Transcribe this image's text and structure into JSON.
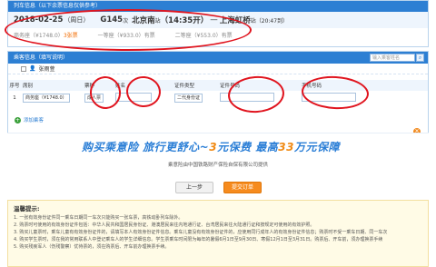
{
  "train": {
    "header_title": "列车信息（以下余票信息仅供参考）",
    "date": "2018-02-25",
    "weekday": "（周日）",
    "train_no": "G145",
    "train_suffix": "次",
    "from_station": "北京南",
    "from_suffix": "站",
    "depart_time": "（14:35开）",
    "arrow": "—",
    "to_station": "上海虹桥",
    "to_suffix": "站",
    "arrive_time": "（20:47到）",
    "seats": [
      {
        "label": "商务座（¥1748.0）",
        "count": "3张票"
      },
      {
        "label": "一等座（¥933.0）",
        "count": "有票"
      },
      {
        "label": "二等座（¥553.0）",
        "count": "有票"
      }
    ]
  },
  "passengers": {
    "header_title": "乘客信息（填写说明）",
    "search_placeholder": "输入乘客姓名",
    "contacts": [
      "张雨萱"
    ],
    "columns": [
      "序号",
      "席别",
      "票种",
      "姓名",
      "证件类型",
      "证件号码",
      "手机号码"
    ],
    "rows": [
      {
        "no": "1",
        "seat": "商务座（¥1748.0）",
        "ticket": "成人票",
        "name": "",
        "id_type": "二代身份证",
        "id_number": "",
        "phone": ""
      }
    ],
    "add_label": "添加乘客"
  },
  "banner": {
    "line_part1": "购买乘意险  旅行更舒心~",
    "line_part2": "3",
    "line_part3": "元保费  最高",
    "line_part4": "33",
    "line_part5": "万元保障",
    "sub": "乘意险由中国铁路财产保险自保有限公司提供"
  },
  "buttons": {
    "prev": "上一步",
    "submit": "提交订单"
  },
  "notice": {
    "title": "温馨提示:",
    "items": [
      "1. 一张有效身份证件同一乘车日期同一车次只能购买一张车票，高铁动卧列车除外。",
      "2. 购票时可使用的有效身份证件包括：中华人民共和国居民身份证、港澳居民来往内地通行证、台湾居民来往大陆通行证和按规定可使用的有效护照。",
      "3. 购买儿童票时，乘车儿童有有效身份证件的，请填写本人有效身份证件信息。乘车儿童没有有效身份证件的，应使用同行成年人的有效身份证件信息；购票时不受一乘车日期、同一车次",
      "4. 购买学生票时，须在我的常用联系人中登记乘车人的学生详细信息。学生票乘车时间限为每年的暑假6月1日至9月30日、寒假12月1日至3月31日。购票后、开车前，须办理换票手续",
      "5. 购买残疾军人（伤残警察）优待票的，须在购票后、开车前办理换票手续。"
    ]
  },
  "colors": {
    "header_blue": "#2d7fd3",
    "accent_orange": "#f68b1e",
    "annotation_red": "#e0141e"
  }
}
